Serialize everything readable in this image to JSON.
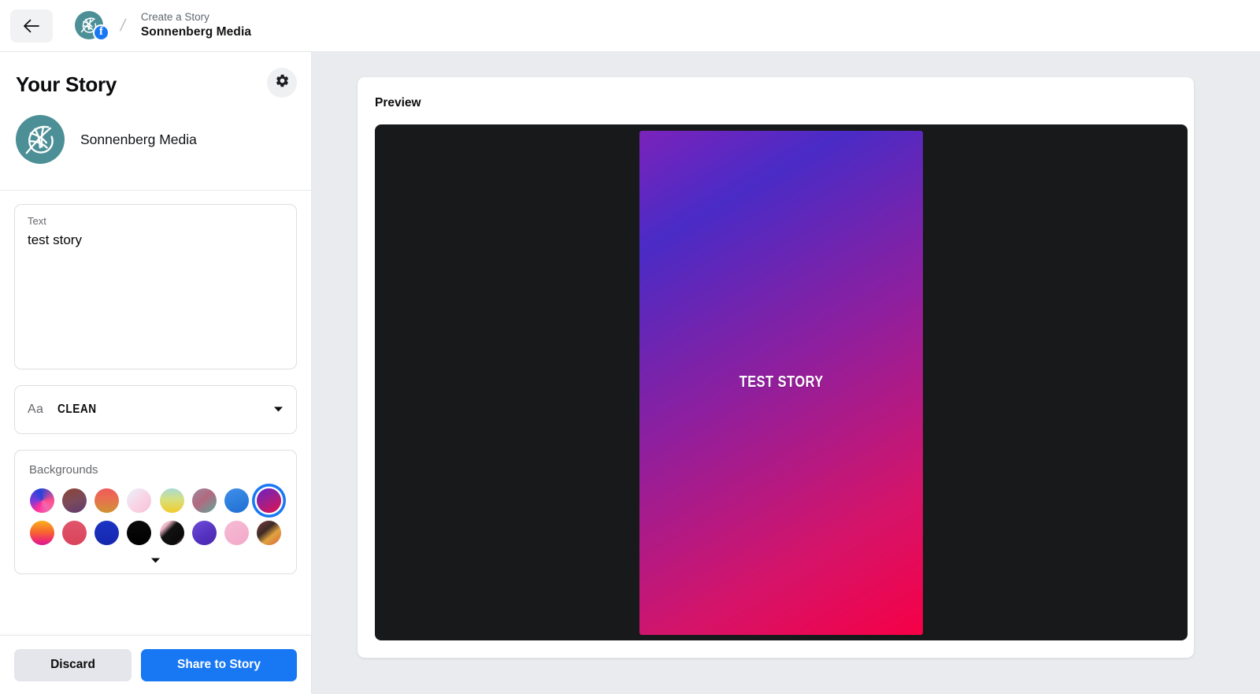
{
  "topbar": {
    "back_icon": "arrow-left-icon",
    "brand_icon": "sonnenberg-leaf-logo",
    "facebook_badge": "f",
    "separator": "/",
    "breadcrumb_top": "Create a Story",
    "breadcrumb_bottom": "Sonnenberg Media"
  },
  "sidebar": {
    "title": "Your Story",
    "settings_icon": "gear-icon",
    "account": {
      "avatar_icon": "sonnenberg-leaf-logo",
      "name": "Sonnenberg Media",
      "avatar_color": "#4d8f96"
    },
    "text_field": {
      "label": "Text",
      "value": "test story",
      "placeholder": "Text"
    },
    "font_select": {
      "icon": "aa-icon",
      "value": "CLEAN",
      "chevron_icon": "chevron-down-icon"
    },
    "backgrounds": {
      "label": "Backgrounds",
      "expand_icon": "chevron-down-icon",
      "selected_index": 7,
      "swatches": [
        {
          "name": "swatch-vivid-ribbon",
          "css": "conic-gradient(from 210deg, #ff2d9b 0deg, #7a3bdb 60deg, #2244d8 140deg, #ff4d8d 240deg, #f06ab0 300deg, #ff2d9b 360deg)"
        },
        {
          "name": "swatch-maroon-plum",
          "css": "linear-gradient(160deg, #8d4434 0%, #7c4a5a 50%, #5e3b70 100%)"
        },
        {
          "name": "swatch-coral-gold",
          "css": "linear-gradient(180deg, #ef5a5a 0%, #e8714f 45%, #d09332 100%)"
        },
        {
          "name": "swatch-pastel-peach",
          "css": "linear-gradient(135deg, #e9f3fb 0%, #f9d3e4 55%, #f6c0d8 100%)"
        },
        {
          "name": "swatch-mint-yellow",
          "css": "linear-gradient(180deg, #a8dbd3 0%, #d6e07f 45%, #f2cb2b 100%)"
        },
        {
          "name": "swatch-mauve-teal",
          "css": "linear-gradient(140deg, #9c8aa0 0%, #b2697f 45%, #5fa79a 100%)"
        },
        {
          "name": "swatch-azure-blue",
          "css": "linear-gradient(160deg, #3f8fe8 0%, #1f6fd4 100%)"
        },
        {
          "name": "swatch-purple-crimson",
          "css": "linear-gradient(150deg, #6a1fc4 0%, #9b2090 45%, #e4104e 100%)"
        },
        {
          "name": "swatch-sunset-orange",
          "css": "linear-gradient(180deg, #fbb01e 0%, #f8682e 45%, #ef2c6e 80%, #d61a9b 100%)"
        },
        {
          "name": "swatch-rose-red",
          "css": "linear-gradient(180deg, #e0566a 0%, #d9435c 100%)"
        },
        {
          "name": "swatch-royal-blue",
          "css": "linear-gradient(180deg, #1c34c4 0%, #1527ae 100%)"
        },
        {
          "name": "swatch-black",
          "css": "linear-gradient(180deg, #0a0a0a 0%, #000000 100%)"
        },
        {
          "name": "swatch-black-confetti",
          "css": "linear-gradient(135deg, #f2c6d6 0%, #efb7c8 22%, #121212 40%, #0a0a0a 78%, #e6a7bd 100%)"
        },
        {
          "name": "swatch-violet-pattern",
          "css": "linear-gradient(150deg, #6f4bd8 0%, #5533c0 55%, #4726ad 100%)"
        },
        {
          "name": "swatch-pink-palm",
          "css": "linear-gradient(150deg, #f6bcd6 0%, #f2a8c8 100%)"
        },
        {
          "name": "swatch-brown-brush",
          "css": "linear-gradient(140deg, #7d3d3a 0%, #3d2b28 38%, #e2a33f 62%, #d8663f 100%)"
        }
      ]
    },
    "footer": {
      "discard_label": "Discard",
      "share_label": "Share to Story",
      "share_color": "#1877f2",
      "discard_color": "#e4e6eb"
    }
  },
  "preview": {
    "title": "Preview",
    "stage_color": "#18191a",
    "story": {
      "text": "TEST STORY",
      "background_css": "linear-gradient(150deg, #7a23ba 0%, #4a2bc6 18%, #8f1f9e 48%, #d4146a 78%, #f60046 100%)",
      "text_color": "#ffffff"
    }
  }
}
